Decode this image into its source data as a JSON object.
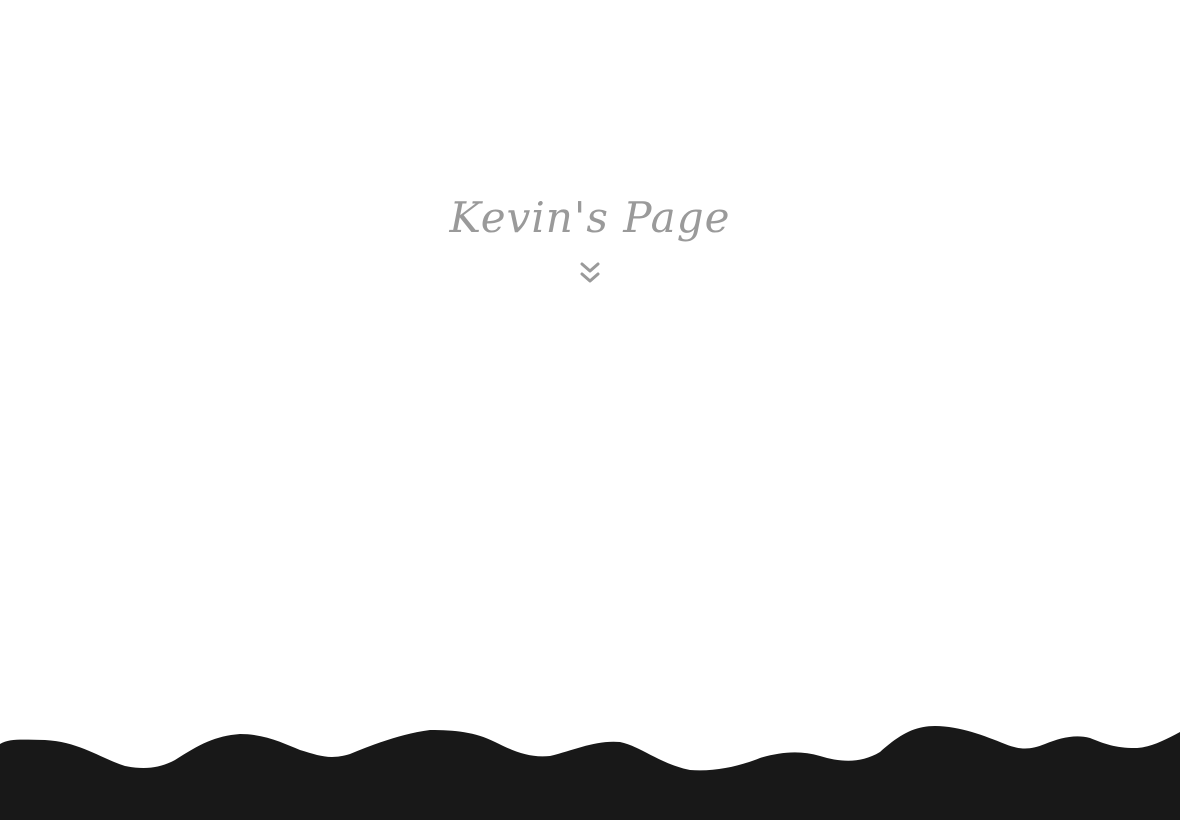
{
  "hero": {
    "title": "Kevin's Page",
    "scroll_icon": "double-chevron-down-icon"
  },
  "colors": {
    "background": "#ffffff",
    "title": "#9a9a9a",
    "footer_wave": "#181818"
  }
}
